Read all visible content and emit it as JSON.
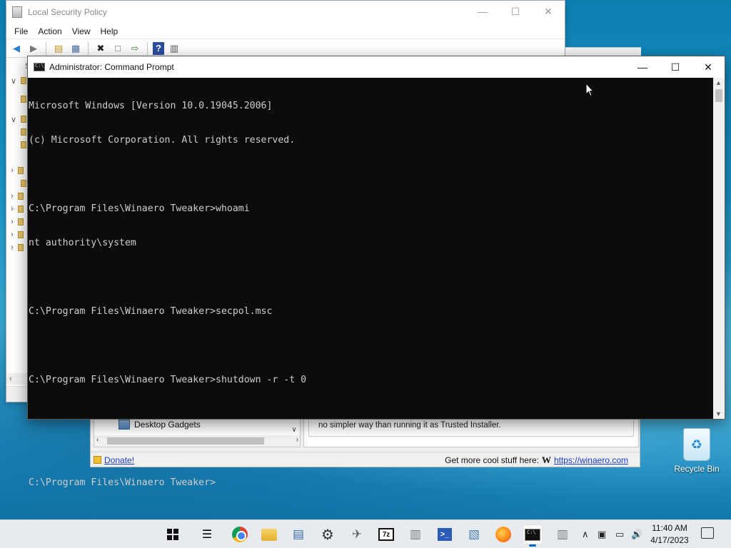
{
  "lsp_window": {
    "title": "Local Security Policy",
    "menu": [
      "File",
      "Action",
      "View",
      "Help"
    ],
    "partial_label": "S"
  },
  "cmd_window": {
    "title": "Administrator: Command Prompt",
    "lines": [
      "Microsoft Windows [Version 10.0.19045.2006]",
      "(c) Microsoft Corporation. All rights reserved.",
      "",
      "C:\\Program Files\\Winaero Tweaker>whoami",
      "nt authority\\system",
      "",
      "C:\\Program Files\\Winaero Tweaker>secpol.msc",
      "",
      "C:\\Program Files\\Winaero Tweaker>shutdown -r -t 0",
      "",
      "",
      "C:\\Program Files\\Winaero Tweaker>"
    ]
  },
  "winaero_window": {
    "tree_item": "Desktop Gadgets",
    "description": "no simpler way than running it as Trusted Installer.",
    "donate_label": "Donate!",
    "cool_stuff_label": "Get more cool stuff here:",
    "winaero_letter": "W",
    "winaero_link": "https://winaero.com"
  },
  "desktop": {
    "recycle_bin_label": "Recycle Bin"
  },
  "taskbar": {
    "apps": [
      "start-icon",
      "task-view-icon",
      "chrome-icon",
      "file-explorer-icon",
      "winaero-tweaker-icon",
      "settings-icon",
      "ribbon-icon",
      "7zip-icon",
      "secpol-icon",
      "powershell-icon",
      "resource-monitor-icon",
      "firefox-icon",
      "command-prompt-icon",
      "security-policy-icon"
    ],
    "sevenzip_label": "7z",
    "powershell_label": ">_",
    "time": "11:40 AM",
    "date": "4/17/2023"
  },
  "colors": {
    "console_bg": "#0c0c0c",
    "console_fg": "#cccccc",
    "taskbar_bg": "#e7ebef",
    "link": "#1a3cc8"
  }
}
